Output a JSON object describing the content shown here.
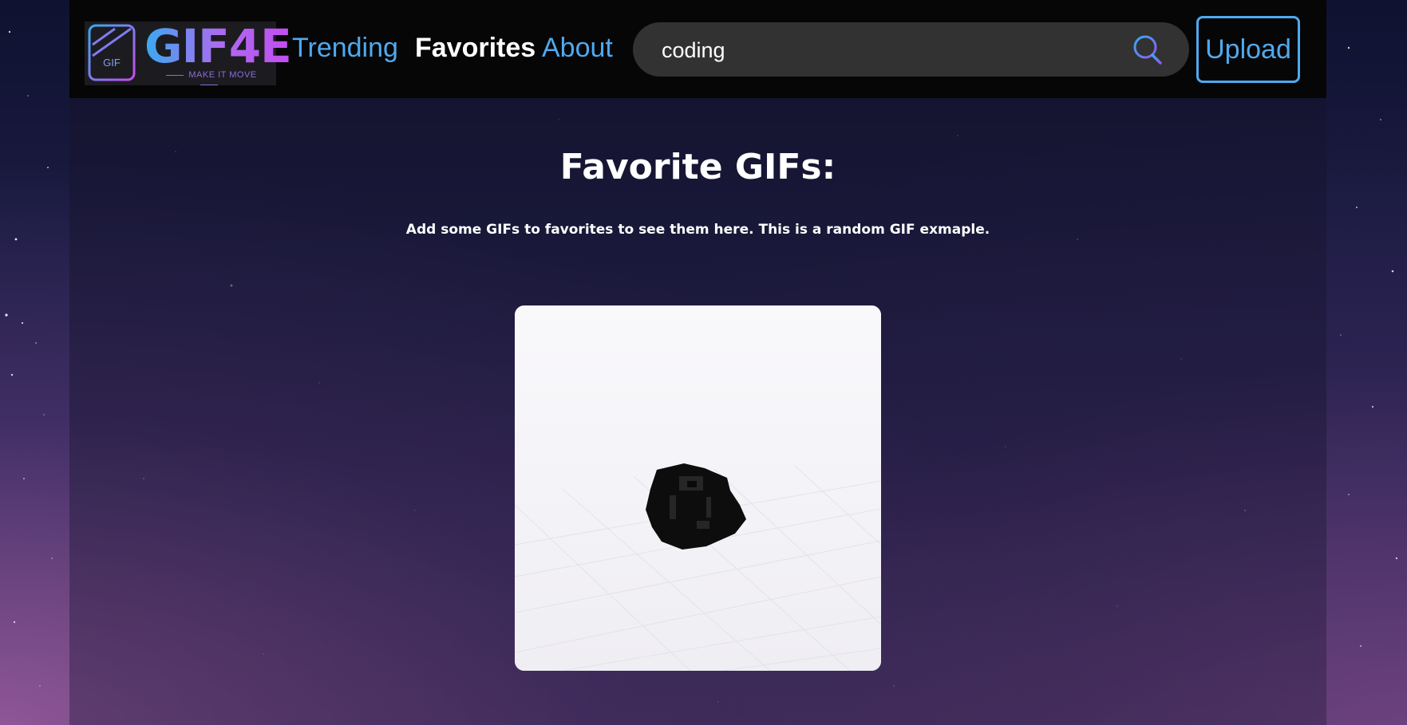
{
  "brand": {
    "logo_word": "GIF4E",
    "badge_text": "GIF",
    "tagline": "MAKE IT MOVE",
    "gradient_start": "#3aa9f0",
    "gradient_end": "#c44df0"
  },
  "nav": {
    "items": [
      {
        "label": "Trending",
        "active": false
      },
      {
        "label": "Favorites",
        "active": true
      },
      {
        "label": "About",
        "active": false
      }
    ],
    "link_color": "#4fa9ef",
    "active_color": "#ffffff"
  },
  "search": {
    "value": "coding",
    "icon": "search-icon"
  },
  "upload": {
    "label": "Upload"
  },
  "main": {
    "title": "Favorite GIFs:",
    "subtitle": "Add some GIFs to favorites to see them here. This is a random GIF exmaple."
  },
  "gif": {
    "icon": "voxel-object-gif"
  }
}
